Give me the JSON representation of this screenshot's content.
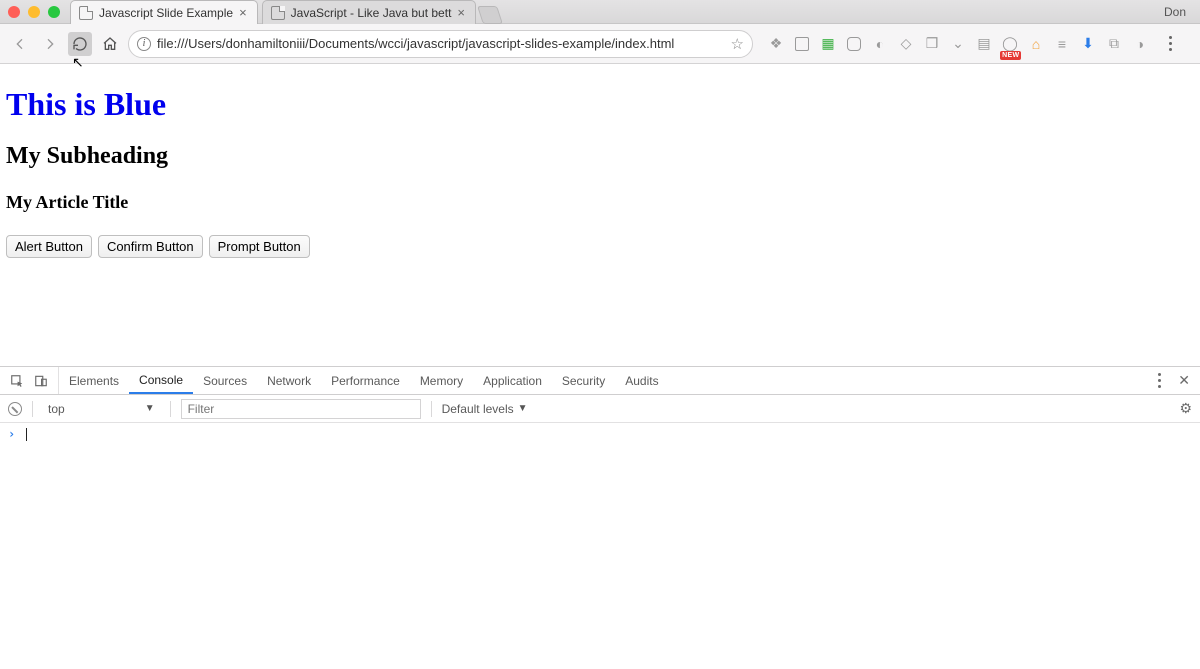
{
  "window": {
    "profile": "Don"
  },
  "tabs": [
    {
      "title": "Javascript Slide Example",
      "active": true
    },
    {
      "title": "JavaScript - Like Java but bett",
      "active": false
    }
  ],
  "address_bar": {
    "url": "file:///Users/donhamiltoniii/Documents/wcci/javascript/javascript-slides-example/index.html"
  },
  "extensions_badge": "NEW",
  "page": {
    "h1": "This is Blue",
    "h2": "My Subheading",
    "h3": "My Article Title",
    "buttons": {
      "alert": "Alert Button",
      "confirm": "Confirm Button",
      "prompt": "Prompt Button"
    }
  },
  "devtools": {
    "panels": [
      "Elements",
      "Console",
      "Sources",
      "Network",
      "Performance",
      "Memory",
      "Application",
      "Security",
      "Audits"
    ],
    "active_panel": "Console",
    "context": "top",
    "filter_placeholder": "Filter",
    "levels_label": "Default levels"
  }
}
